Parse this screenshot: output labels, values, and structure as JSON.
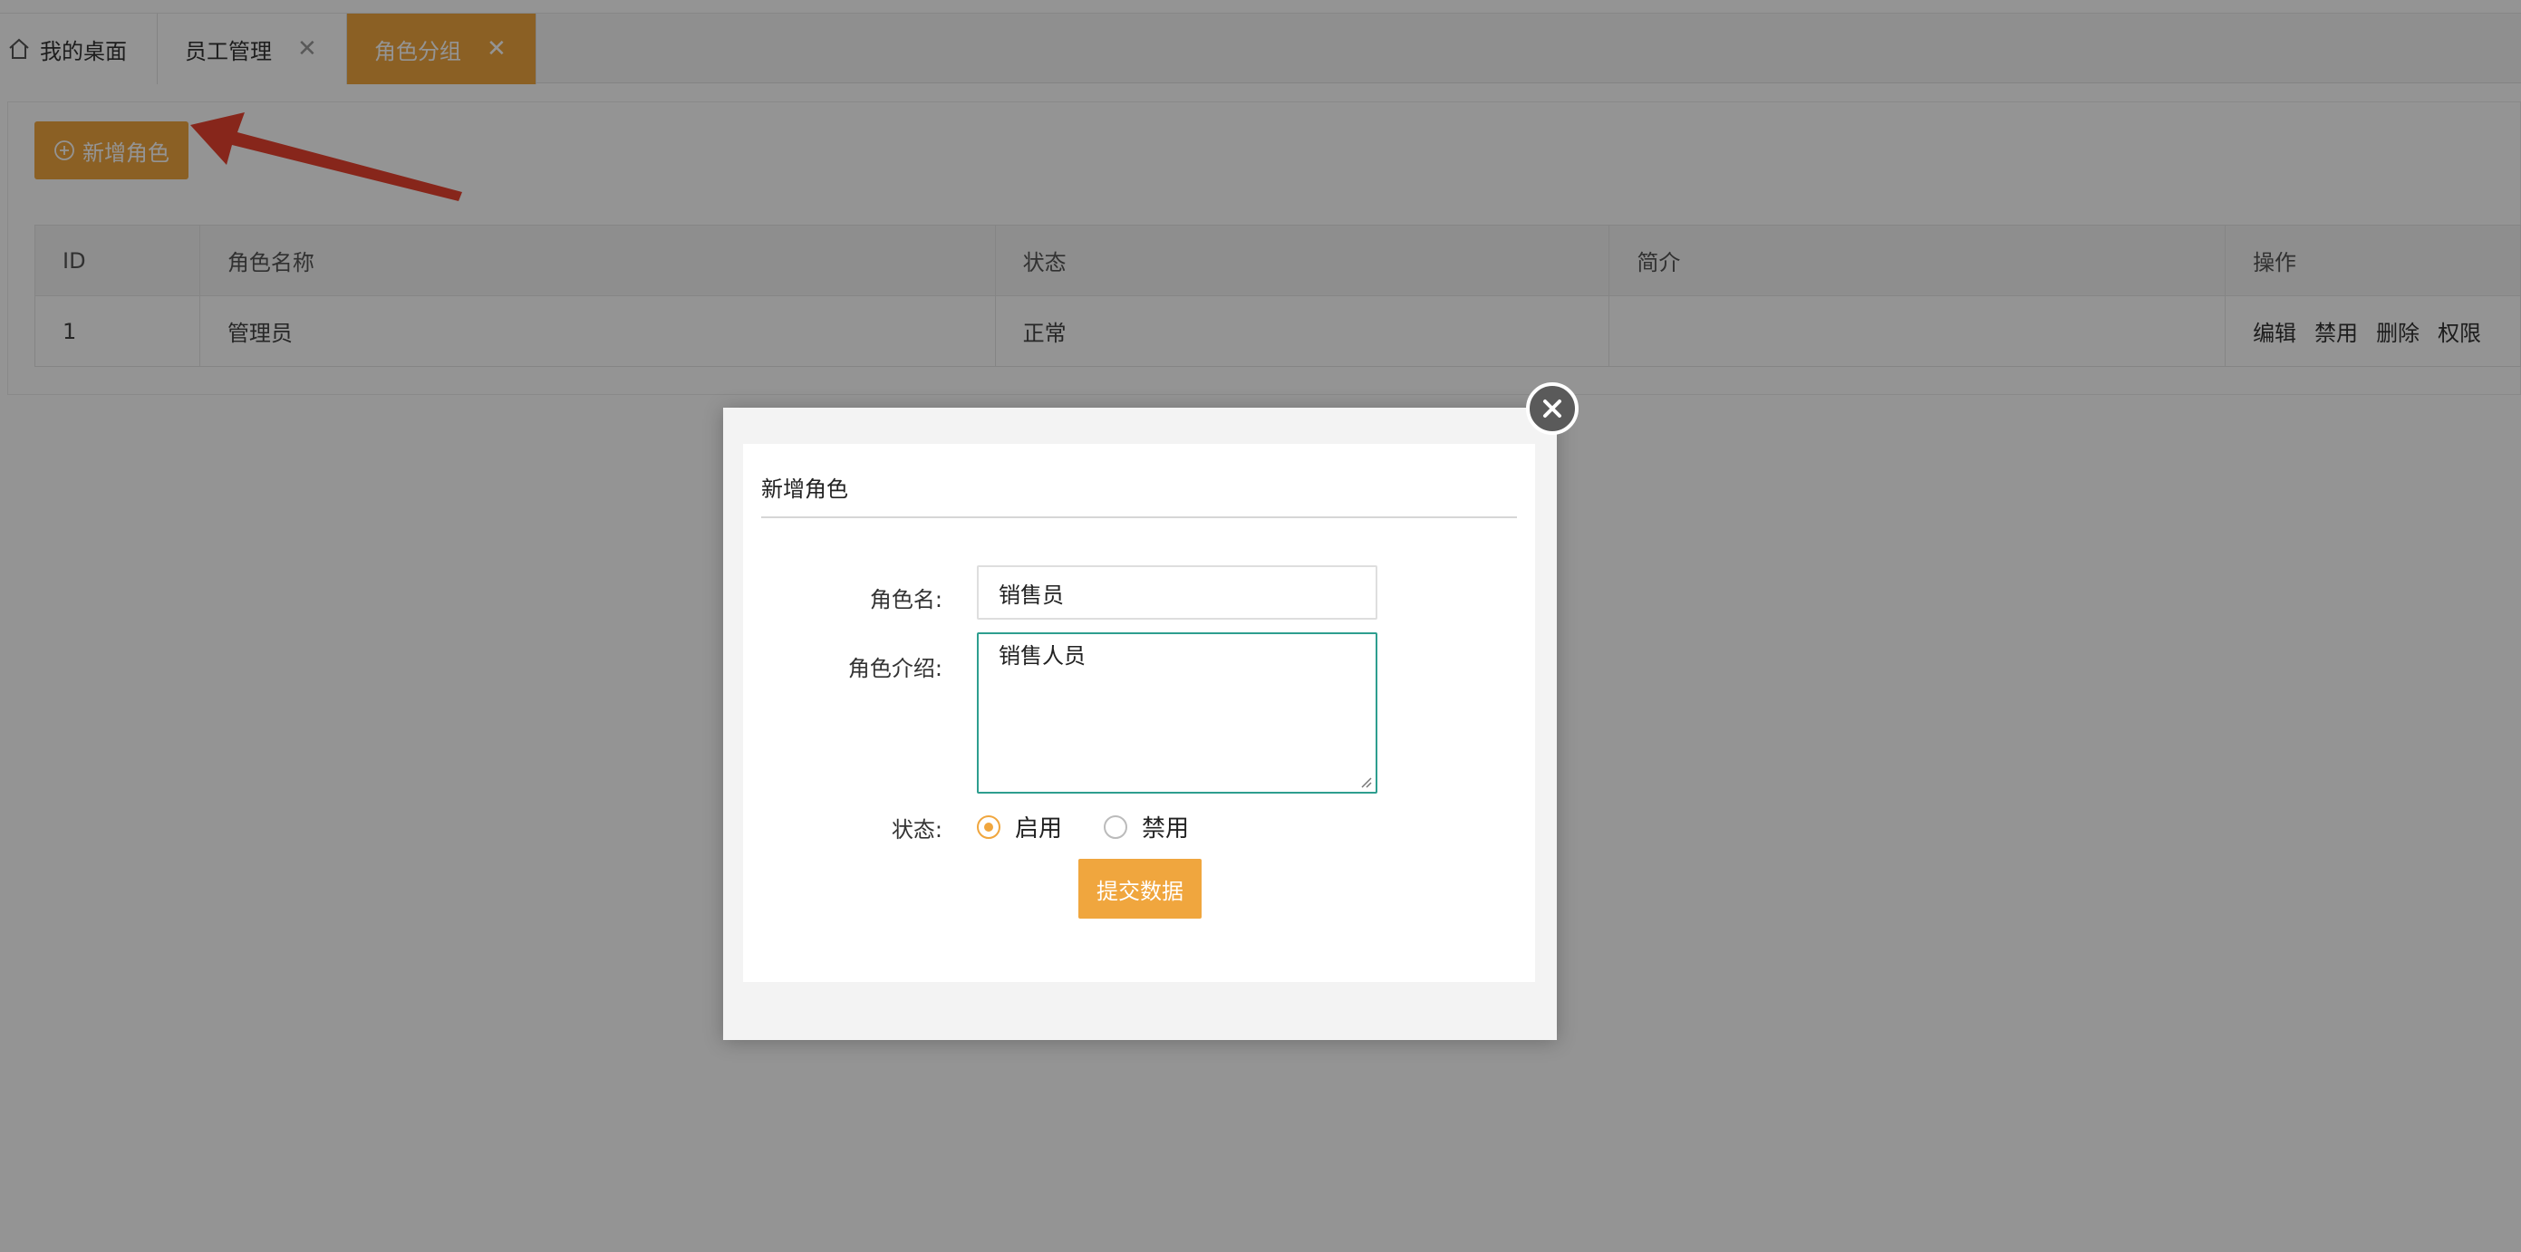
{
  "tabs": [
    {
      "label": "我的桌面",
      "icon": "home-icon",
      "closable": false
    },
    {
      "label": "员工管理",
      "closable": true
    },
    {
      "label": "角色分组",
      "closable": true,
      "active": true
    }
  ],
  "toolbar": {
    "add_label": "新增角色"
  },
  "table": {
    "headers": [
      "ID",
      "角色名称",
      "状态",
      "简介",
      "操作"
    ],
    "rows": [
      {
        "id": "1",
        "name": "管理员",
        "status": "正常",
        "desc": "",
        "ops": [
          "编辑",
          "禁用",
          "删除",
          "权限"
        ]
      }
    ]
  },
  "modal": {
    "title": "新增角色",
    "name_label": "角色名:",
    "name_value": "销售员",
    "desc_label": "角色介绍:",
    "desc_value": "销售人员",
    "status_label": "状态:",
    "status_options": [
      "启用",
      "禁用"
    ],
    "status_selected": "启用",
    "submit_label": "提交数据"
  },
  "colors": {
    "accent": "#f0a63e",
    "focus_border": "#2e9e8f",
    "arrow": "#e9432f"
  }
}
